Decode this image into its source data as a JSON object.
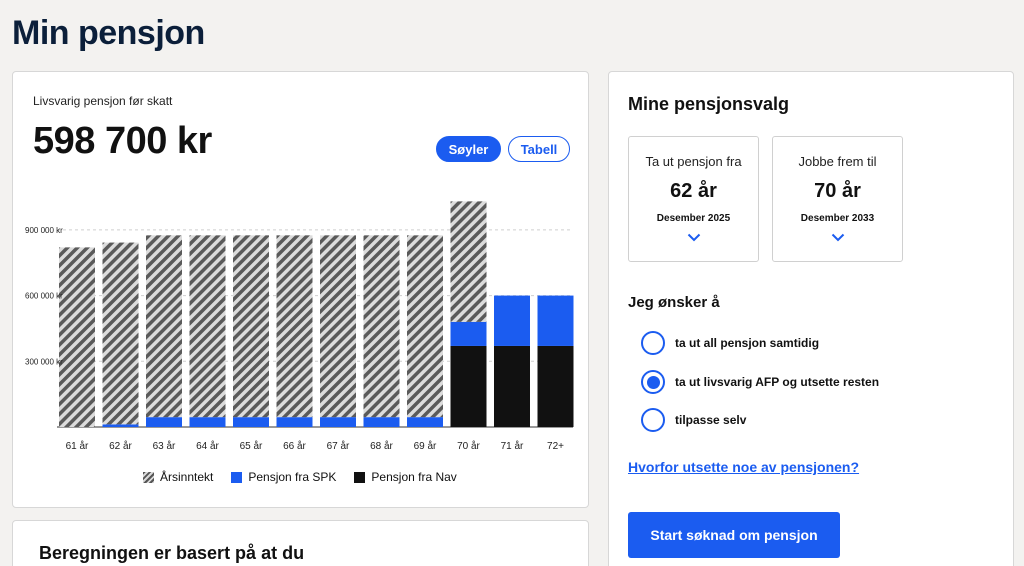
{
  "page": {
    "title": "Min pensjon"
  },
  "chart_card": {
    "sublabel": "Livsvarig pensjon før skatt",
    "amount": "598 700 kr",
    "toggle": {
      "bars_label": "Søyler",
      "table_label": "Tabell",
      "selected": "Søyler"
    }
  },
  "chart_data": {
    "type": "bar",
    "stacked": true,
    "categories": [
      "61 år",
      "62 år",
      "63 år",
      "64 år",
      "65 år",
      "66 år",
      "67 år",
      "68 år",
      "69 år",
      "70 år",
      "71 år",
      "72+"
    ],
    "series": [
      {
        "name": "Pensjon fra Nav",
        "color": "#111111",
        "values": [
          0,
          0,
          0,
          0,
          0,
          0,
          0,
          0,
          0,
          370000,
          370000,
          370000
        ]
      },
      {
        "name": "Pensjon fra SPK",
        "color": "#1b5cf0",
        "values": [
          0,
          12000,
          45000,
          45000,
          45000,
          45000,
          45000,
          45000,
          45000,
          110000,
          230000,
          230000
        ]
      },
      {
        "name": "Årsinntekt",
        "color": "#555555",
        "pattern": "hatch",
        "values": [
          820000,
          830000,
          830000,
          830000,
          830000,
          830000,
          830000,
          830000,
          830000,
          550000,
          0,
          0
        ]
      }
    ],
    "y_ticks": [
      {
        "value": 300000,
        "label": "300 000 kr"
      },
      {
        "value": 600000,
        "label": "600 000 kr"
      },
      {
        "value": 900000,
        "label": "900 000 kr"
      }
    ],
    "ylim": [
      0,
      1050000
    ],
    "grid": true,
    "legend_position": "bottom"
  },
  "legend": {
    "items": [
      {
        "label": "Årsinntekt",
        "icon": "hatch-swatch"
      },
      {
        "label": "Pensjon fra SPK",
        "color": "#1b5cf0"
      },
      {
        "label": "Pensjon fra Nav",
        "color": "#111111"
      }
    ]
  },
  "options_card": {
    "title": "Mine pensjonsvalg",
    "choices": [
      {
        "label": "Ta ut pensjon fra",
        "value": "62 år",
        "date": "Desember 2025"
      },
      {
        "label": "Jobbe frem til",
        "value": "70 år",
        "date": "Desember 2033"
      }
    ],
    "wish_title": "Jeg ønsker å",
    "radios": [
      {
        "label": "ta ut all pensjon samtidig",
        "checked": false
      },
      {
        "label": "ta ut livsvarig AFP og utsette resten",
        "checked": true
      },
      {
        "label": "tilpasse selv",
        "checked": false
      }
    ],
    "link_text": "Hvorfor utsette noe av pensjonen?",
    "start_button": "Start søknad om pensjon"
  },
  "bottom_card": {
    "title": "Beregningen er basert på at du"
  },
  "colors": {
    "accent": "#1b5cf0",
    "title": "#0b1f3a",
    "nav_black": "#111111"
  }
}
